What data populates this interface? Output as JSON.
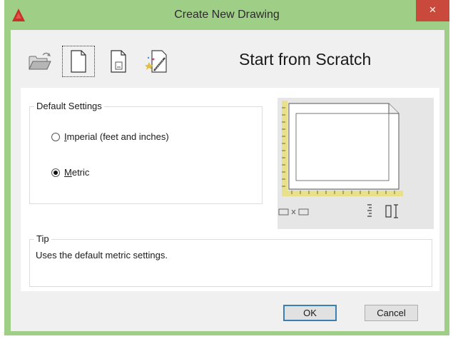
{
  "window": {
    "title": "Create New Drawing",
    "close_glyph": "×",
    "app_icon": "autocad-logo-icon",
    "frame_color": "#9fcf86",
    "close_color": "#c94a3d"
  },
  "toolbar": {
    "buttons": [
      {
        "name": "open-drawing",
        "icon": "open-folder-icon"
      },
      {
        "name": "start-from-scratch",
        "icon": "blank-page-icon",
        "selected": true
      },
      {
        "name": "use-a-template",
        "icon": "template-page-icon"
      },
      {
        "name": "use-a-wizard",
        "icon": "wizard-icon"
      }
    ],
    "heading": "Start from Scratch"
  },
  "default_settings": {
    "legend": "Default Settings",
    "options": [
      {
        "mnemonic": "I",
        "rest": "mperial (feet and inches)",
        "checked": false
      },
      {
        "mnemonic": "M",
        "rest": "etric",
        "checked": true
      }
    ]
  },
  "preview": {
    "icons": [
      "sheet-preview-icon",
      "width-by-height-icon",
      "vertical-ruler-icon"
    ]
  },
  "tip": {
    "legend": "Tip",
    "text": "Uses the default metric settings."
  },
  "buttons": {
    "ok": "OK",
    "cancel": "Cancel"
  }
}
